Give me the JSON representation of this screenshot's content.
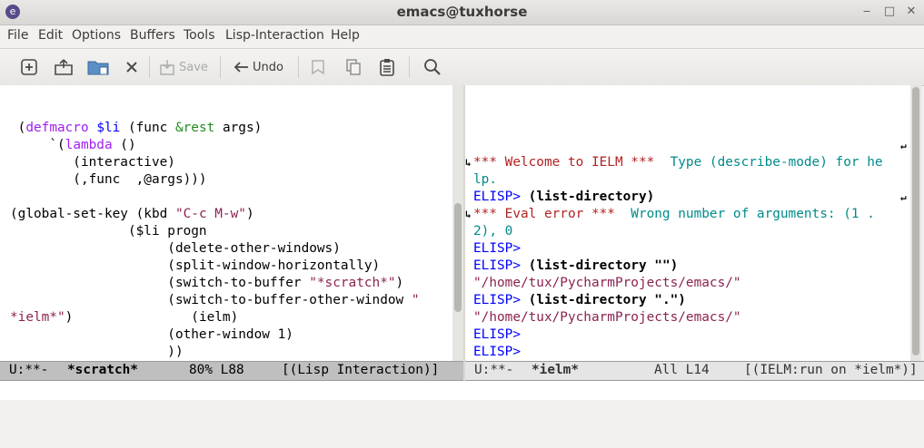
{
  "window": {
    "title": "emacs@tuxhorse",
    "icon": "emacs-icon",
    "controls": {
      "minimize": "‒",
      "maximize": "□",
      "close": "✕"
    }
  },
  "menu": [
    "File",
    "Edit",
    "Options",
    "Buffers",
    "Tools",
    "Lisp-Interaction",
    "Help"
  ],
  "toolbar": {
    "new_icon": "new-file-icon",
    "open_icon": "open-folder-icon",
    "dired_icon": "dired-icon",
    "close_icon": "close-buffer-icon",
    "save_label": "Save",
    "save_icon": "save-icon",
    "undo_label": "Undo",
    "undo_icon": "undo-icon",
    "cut_icon": "cut-icon",
    "copy_icon": "copy-icon",
    "paste_icon": "paste-icon",
    "search_icon": "search-icon"
  },
  "left_buffer": {
    "lines": [
      "",
      " (defmacro $li (func &rest args)",
      "     `(lambda ()",
      "        (interactive)",
      "        (,func  ,@args)))",
      "",
      "(global-set-key (kbd \"C-c M-w\")",
      "               ($li progn",
      "                    (delete-other-windows)",
      "                    (split-window-horizontally)",
      "                    (switch-to-buffer \"*scratch*\")",
      "                    (switch-to-buffer-other-window \"",
      "*ielm*\")               (ielm)",
      "                    (other-window 1)",
      "                    ))",
      ""
    ],
    "modeline": {
      "status": "U:**-",
      "buffer": "*scratch*",
      "position": "80% L88",
      "mode": "[(Lisp Interaction)]"
    }
  },
  "right_buffer": {
    "lines": [
      "",
      "",
      "",
      "*** Welcome to IELM ***  Type (describe-mode) for he",
      "lp.",
      "ELISP> (list-directory)",
      "*** Eval error ***  Wrong number of arguments: (1 .",
      "2), 0",
      "ELISP>",
      "ELISP> (list-directory \"\")",
      "\"/home/tux/PycharmProjects/emacs/\"",
      "ELISP> (list-directory \".\")",
      "\"/home/tux/PycharmProjects/emacs/\"",
      "ELISP>",
      "ELISP>",
      "ELISP> "
    ],
    "modeline": {
      "status": "U:**-",
      "buffer": "*ielm*",
      "position": "All L14",
      "mode": "[(IELM:run on *ielm*)]"
    }
  },
  "colors": {
    "keyword": "#a020f0",
    "function": "#0000ff",
    "type": "#228b22",
    "string": "#8b2252",
    "error": "#b22222",
    "info": "#008b8b"
  }
}
